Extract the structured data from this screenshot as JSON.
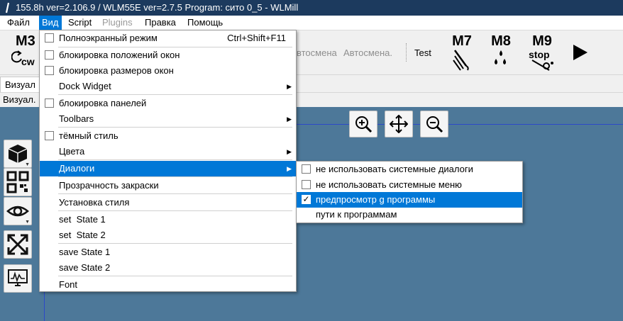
{
  "window": {
    "title": "155.8h ver=2.106.9 / WLM55E ver=2.7.5   Program: сито 0_5 - WLMill"
  },
  "menubar": {
    "items": [
      {
        "label": "Файл"
      },
      {
        "label": "Вид"
      },
      {
        "label": "Script"
      },
      {
        "label": "Plugins"
      },
      {
        "label": "Правка"
      },
      {
        "label": "Помощь"
      }
    ]
  },
  "toolbar": {
    "m3_label": "M3",
    "m3_sub": "cw",
    "auto_label_partial": "втосмена",
    "auto_label2": "Автосмена.",
    "test_label": "Test",
    "m7_label": "M7",
    "m8_label": "M8",
    "m9_label": "M9",
    "m9_sub": "stop"
  },
  "tabs": {
    "active_partial": "Визуал"
  },
  "subbar": {
    "label_partial": "Визуал."
  },
  "view_menu": {
    "items": [
      {
        "label": "Полноэкранный режим",
        "shortcut": "Ctrl+Shift+F11",
        "checkbox": true
      },
      {
        "label": "блокировка положений окон",
        "checkbox": true
      },
      {
        "label": "блокировка размеров окон",
        "checkbox": true
      },
      {
        "label": "Dock Widget",
        "submenu": true
      },
      {
        "label": "блокировка панелей",
        "checkbox": true
      },
      {
        "label": "Toolbars",
        "submenu": true
      },
      {
        "label": "тёмный стиль",
        "checkbox": true
      },
      {
        "label": "Цвета",
        "submenu": true
      },
      {
        "label": "Диалоги",
        "submenu": true,
        "highlighted": true
      },
      {
        "label": "Прозрачность закраски"
      },
      {
        "label": "Установка стиля"
      },
      {
        "label": "set  State 1"
      },
      {
        "label": "set  State 2"
      },
      {
        "label": "save State 1"
      },
      {
        "label": "save State 2"
      },
      {
        "label": "Font"
      }
    ]
  },
  "dialogs_submenu": {
    "items": [
      {
        "label": "не использовать системные диалоги",
        "checked": false
      },
      {
        "label": "не использовать системные меню",
        "checked": false
      },
      {
        "label": "предпросмотр g программы",
        "checked": true,
        "highlighted": true
      },
      {
        "label": "пути к программам"
      }
    ],
    "check_mark": "✓"
  },
  "arrow_glyph": "▶",
  "colors": {
    "accent": "#0078d7",
    "titlebar": "#1c3a5e",
    "viewport": "#4d7899",
    "axis": "#2d49c8"
  }
}
